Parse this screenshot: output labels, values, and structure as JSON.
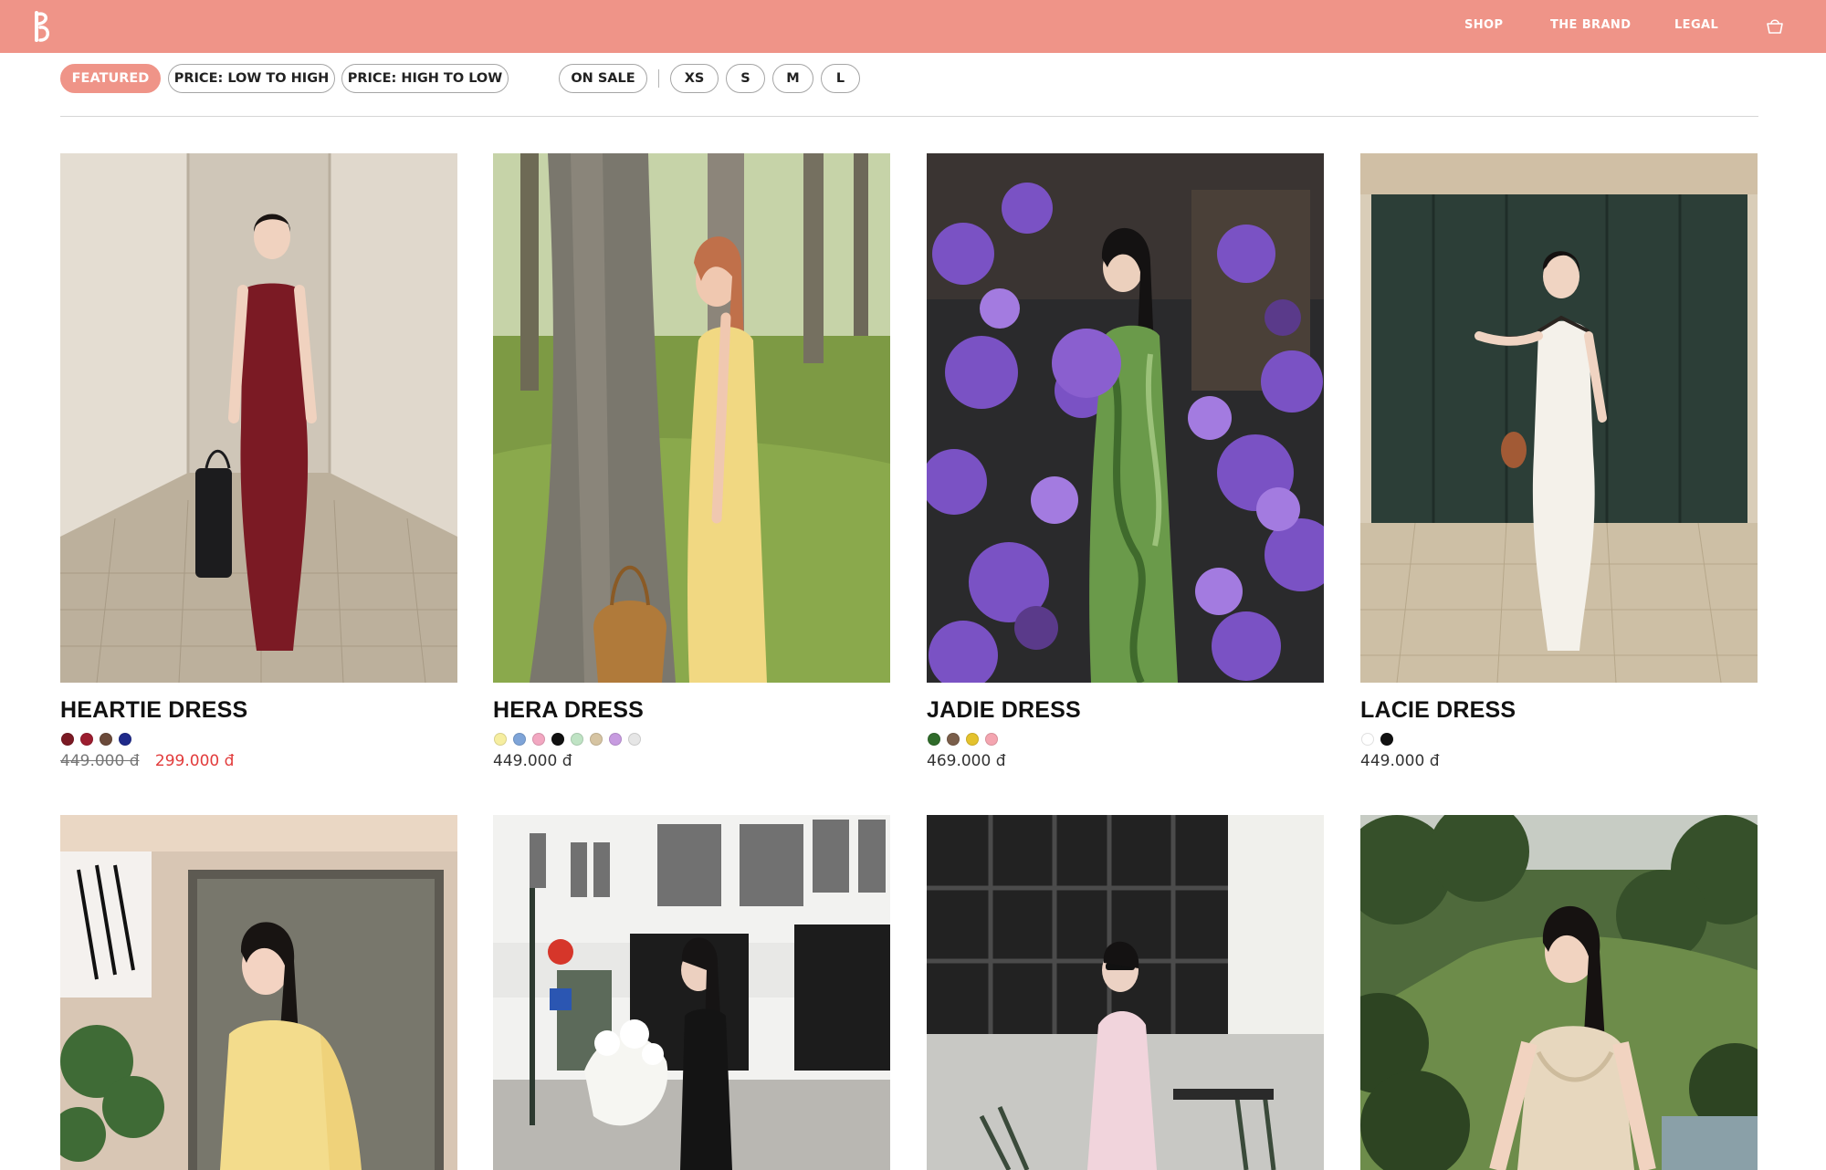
{
  "header": {
    "nav": {
      "shop": "SHOP",
      "brand": "THE BRAND",
      "legal": "LEGAL"
    },
    "icons": {
      "logo": "brand-logo",
      "cart": "shopping-basket-icon"
    },
    "background": "#ef9488"
  },
  "filters": {
    "sort": [
      "FEATURED",
      "PRICE: LOW TO HIGH",
      "PRICE: HIGH TO LOW"
    ],
    "active": "FEATURED",
    "on_sale": "ON SALE",
    "sizes": [
      "XS",
      "S",
      "M",
      "L"
    ]
  },
  "products": [
    {
      "name": "HEARTIE DRESS",
      "colors": [
        "#7b1a24",
        "#9c1d2f",
        "#6b4a3a",
        "#1f2a8a"
      ],
      "price_old": "449.000 đ",
      "price": "299.000 đ",
      "on_sale": true
    },
    {
      "name": "HERA DRESS",
      "colors": [
        "#f6eea0",
        "#7ea4d8",
        "#f2a7c1",
        "#111111",
        "#bfe3c4",
        "#d6c4a2",
        "#c79be0",
        "#e6e6e6"
      ],
      "price": "449.000 đ"
    },
    {
      "name": "JADIE DRESS",
      "colors": [
        "#2f6b2a",
        "#7a5e4a",
        "#e4c22d",
        "#f4a5b0"
      ],
      "price": "469.000 đ"
    },
    {
      "name": "LACIE DRESS",
      "colors": [
        "#ffffff",
        "#111111"
      ],
      "price": "449.000 đ"
    },
    {
      "name": "",
      "colors": []
    },
    {
      "name": "",
      "colors": []
    },
    {
      "name": "",
      "colors": []
    },
    {
      "name": "",
      "colors": []
    }
  ],
  "accent_colors": {
    "brand": "#ef9488",
    "sale": "#e23b3b"
  }
}
